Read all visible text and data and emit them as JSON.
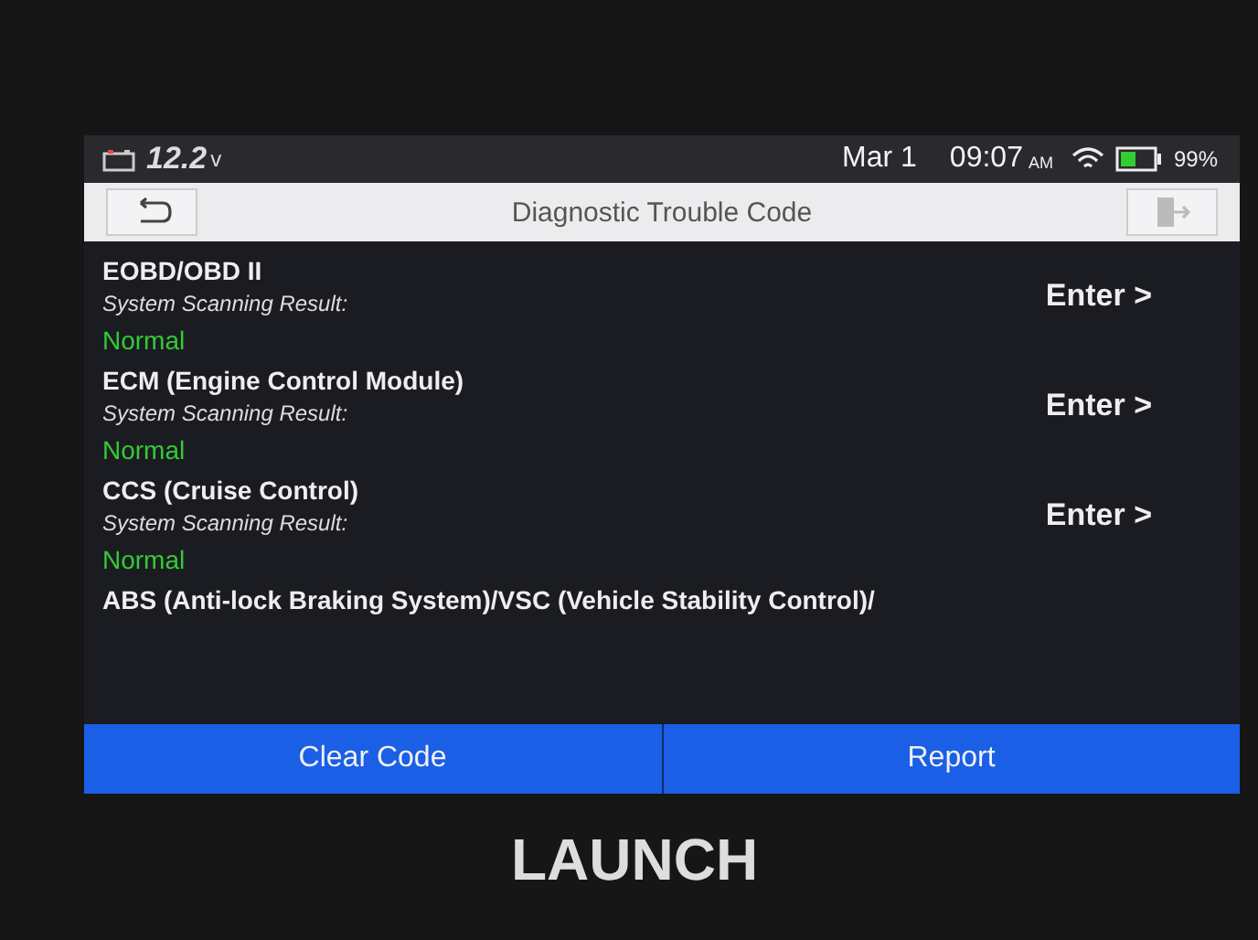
{
  "status_bar": {
    "voltage": "12.2",
    "voltage_unit": "v",
    "date": "Mar 1",
    "time": "09:07",
    "meridiem": "AM",
    "battery_percent": "99%"
  },
  "header": {
    "title": "Diagnostic Trouble Code"
  },
  "systems": [
    {
      "name": "EOBD/OBD II",
      "caption": "System Scanning Result:",
      "result": "Normal",
      "action": "Enter >"
    },
    {
      "name": "ECM (Engine Control Module)",
      "caption": "System Scanning Result:",
      "result": "Normal",
      "action": "Enter >"
    },
    {
      "name": "CCS (Cruise Control)",
      "caption": "System Scanning Result:",
      "result": "Normal",
      "action": "Enter >"
    },
    {
      "name": "ABS (Anti-lock Braking System)/VSC (Vehicle Stability Control)/"
    }
  ],
  "buttons": [
    "Clear Code",
    "Report"
  ],
  "brand": "LAUNCH"
}
